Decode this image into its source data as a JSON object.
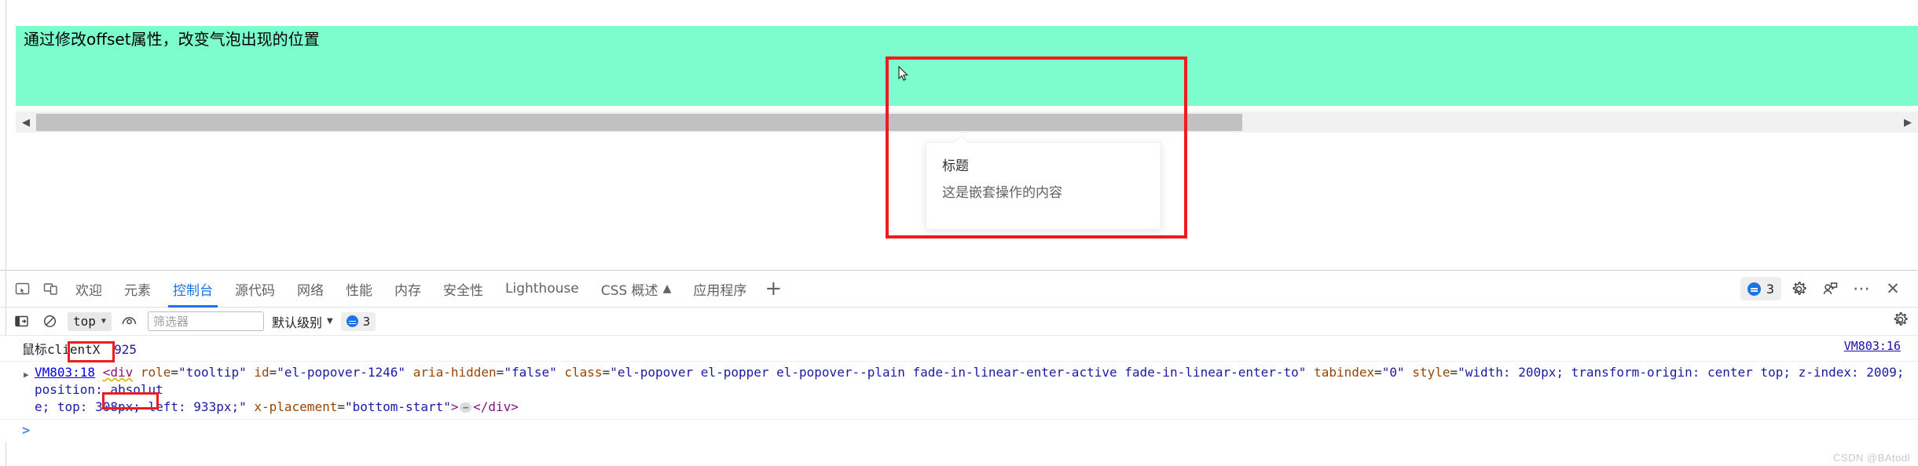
{
  "page": {
    "caption": "通过修改offset属性，改变气泡出现的位置",
    "green_band_color": "#7dfcce",
    "annotation_color": "#ee1c1c",
    "scrollbar": {
      "left_arrow": "◀",
      "right_arrow": "▶"
    }
  },
  "popover": {
    "title": "标题",
    "content": "这是嵌套操作的内容"
  },
  "devtools": {
    "tabs": [
      {
        "label": "欢迎",
        "active": false
      },
      {
        "label": "元素",
        "active": false
      },
      {
        "label": "控制台",
        "active": true
      },
      {
        "label": "源代码",
        "active": false
      },
      {
        "label": "网络",
        "active": false
      },
      {
        "label": "性能",
        "active": false
      },
      {
        "label": "内存",
        "active": false
      },
      {
        "label": "安全性",
        "active": false
      },
      {
        "label": "Lighthouse",
        "active": false
      },
      {
        "label": "CSS 概述",
        "active": false,
        "badge": "▲"
      },
      {
        "label": "应用程序",
        "active": false
      }
    ],
    "add_tab_label": "+",
    "message_count": "3",
    "close_label": "✕",
    "more_label": "⋯"
  },
  "console_toolbar": {
    "context": "top",
    "filter_placeholder": "筛选器",
    "level": "默认级别",
    "badge_count": "3"
  },
  "console": {
    "log_row": {
      "text": "鼠标clientX",
      "value": "925",
      "source": "VM803:16"
    },
    "dom_row": {
      "source": "VM803:18",
      "line1": "<div role=\"tooltip\" id=\"el-popover-1246\" aria-hidden=\"false\" class=\"el-popover el-popper el-popover--plain fade-in-linear-enter-active fade-in-linear-enter-to\" tabindex=\"0\" style=\"width: 200px; transform-origin: center top; z-index: 2009; position: absolut",
      "line2": "e; top: 308px; left: 933px;\" x-placement=\"bottom-start\">⋯</div>",
      "parts": {
        "tag_open": "<div",
        "attr_role": "role",
        "val_role": "\"tooltip\"",
        "attr_id": "id",
        "val_id": "\"el-popover-1246\"",
        "attr_aria": "aria-hidden",
        "val_aria": "\"false\"",
        "attr_class": "class",
        "val_class": "\"el-popover el-popper el-popover--plain fade-in-linear-enter-active fade-in-linear-enter-to\"",
        "attr_tabindex": "tabindex",
        "val_tabindex": "\"0\"",
        "attr_style": "style",
        "val_style_1": "\"width: 200px; transform-origin: center top; z-index: 2009; position: absolut",
        "val_style_2": "e; top: 308px; ",
        "val_style_highlight": "left: 933px;",
        "val_style_3": "\"",
        "attr_placement": "x-placement",
        "val_placement": "\"bottom-start\"",
        "gt": ">",
        "ellipsis": "⋯",
        "tag_close": "</div>"
      }
    },
    "prompt": ">"
  },
  "watermark": "CSDN @BAtodl"
}
